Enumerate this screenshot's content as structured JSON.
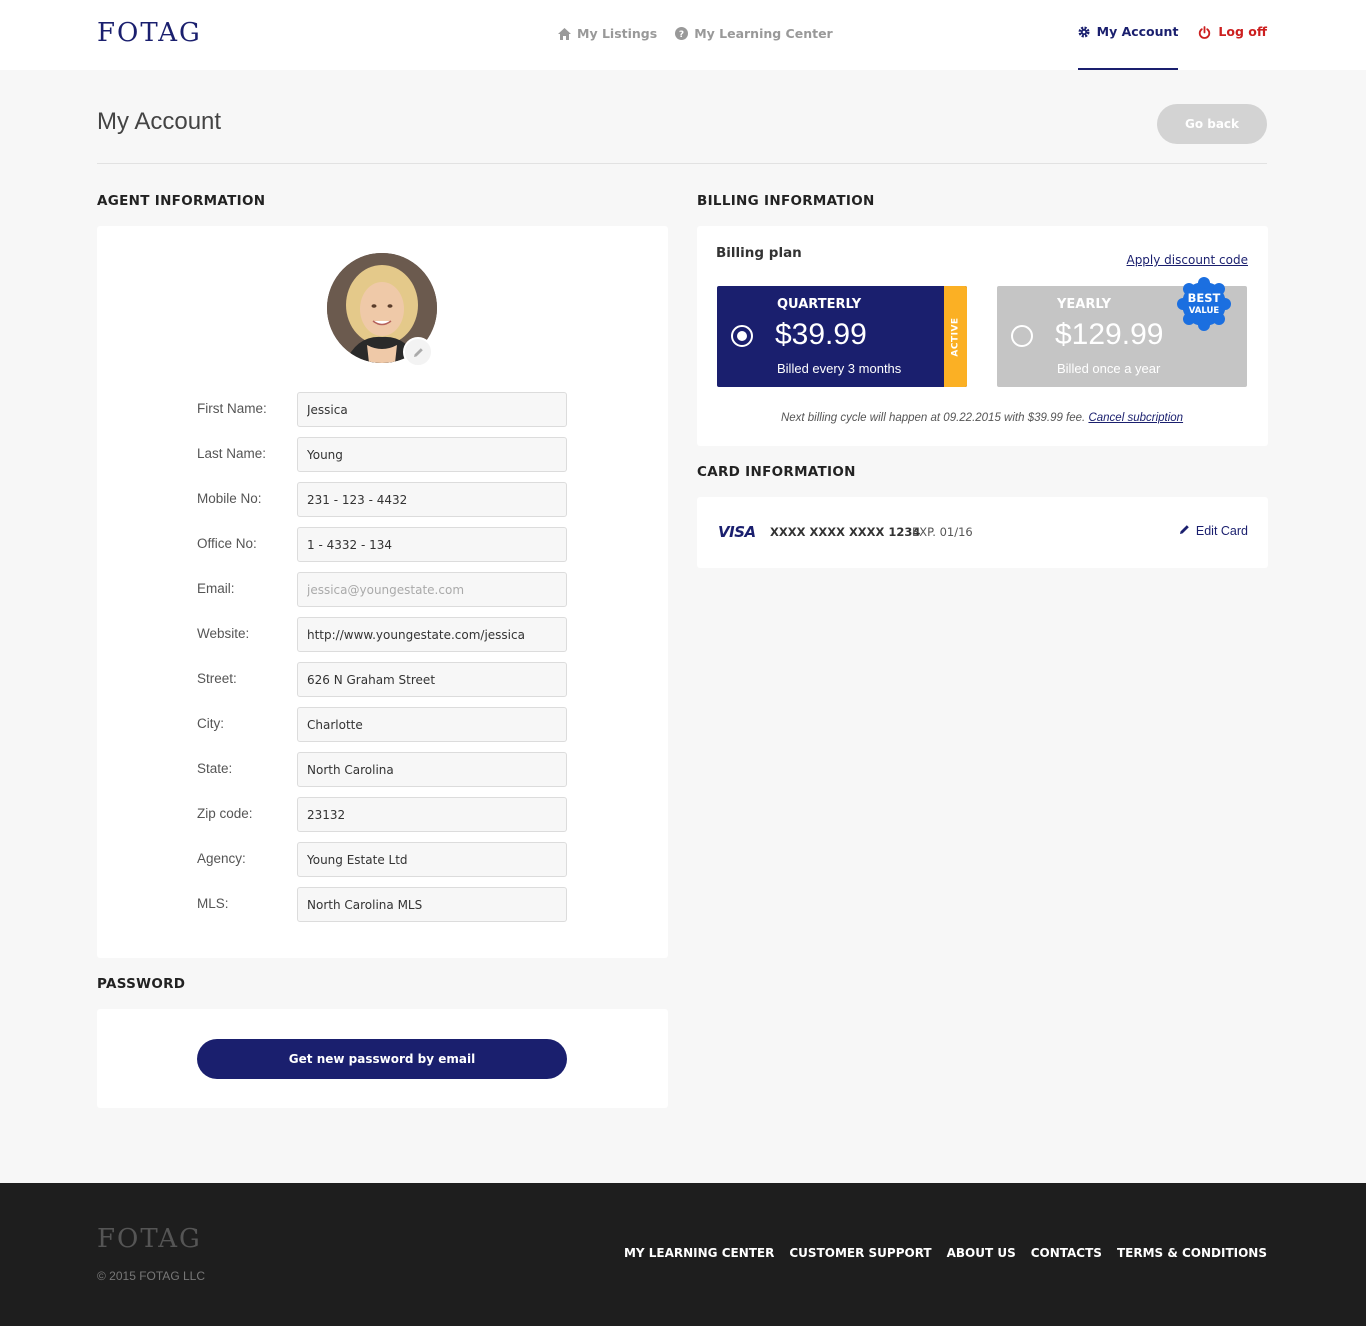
{
  "header": {
    "logo": "FOTAG",
    "nav": [
      {
        "label": "My Listings",
        "icon": "home-icon"
      },
      {
        "label": "My Learning Center",
        "icon": "question-circle-icon"
      }
    ],
    "account_label": "My Account",
    "logoff_label": "Log off"
  },
  "page": {
    "title": "My Account",
    "go_back_label": "Go back"
  },
  "agent": {
    "heading": "AGENT INFORMATION",
    "fields": [
      {
        "label": "First Name:",
        "value": "Jessica",
        "placeholder": ""
      },
      {
        "label": "Last Name:",
        "value": "Young",
        "placeholder": ""
      },
      {
        "label": "Mobile No:",
        "value": "231 - 123 - 4432",
        "placeholder": ""
      },
      {
        "label": "Office No:",
        "value": "1 - 4332 - 134",
        "placeholder": ""
      },
      {
        "label": "Email:",
        "value": "",
        "placeholder": "jessica@youngestate.com"
      },
      {
        "label": "Website:",
        "value": "http://www.youngestate.com/jessica",
        "placeholder": ""
      },
      {
        "label": "Street:",
        "value": "626 N Graham Street",
        "placeholder": ""
      },
      {
        "label": "City:",
        "value": "Charlotte",
        "placeholder": ""
      },
      {
        "label": "State:",
        "value": "North Carolina",
        "placeholder": ""
      },
      {
        "label": "Zip code:",
        "value": "23132",
        "placeholder": ""
      },
      {
        "label": "Agency:",
        "value": "Young Estate Ltd",
        "placeholder": ""
      },
      {
        "label": "MLS:",
        "value": "North Carolina MLS",
        "placeholder": ""
      }
    ]
  },
  "password": {
    "heading": "PASSWORD",
    "button_label": "Get new password by email"
  },
  "billing": {
    "heading": "BILLING INFORMATION",
    "plan_label": "Billing plan",
    "discount_link": "Apply discount code",
    "plans": [
      {
        "name": "QUARTERLY",
        "price": "$39.99",
        "sub": "Billed every 3 months",
        "selected": true,
        "badge": "ACTIVE"
      },
      {
        "name": "YEARLY",
        "price": "$129.99",
        "sub": "Billed once a year",
        "selected": false,
        "badge_line1": "BEST",
        "badge_line2": "VALUE"
      }
    ],
    "note": "Next billing cycle will happen at 09.22.2015 with $39.99 fee.",
    "cancel_link": "Cancel subcription"
  },
  "card": {
    "heading": "CARD INFORMATION",
    "brand": "VISA",
    "number": "XXXX XXXX XXXX 1234",
    "expiry": "EXP. 01/16",
    "edit_label": "Edit Card"
  },
  "footer": {
    "logo": "FOTAG",
    "copyright": "© 2015 FOTAG LLC",
    "links": [
      "MY LEARNING CENTER",
      "CUSTOMER SUPPORT",
      "ABOUT US",
      "CONTACTS",
      "TERMS & CONDITIONS"
    ]
  },
  "colors": {
    "brand_navy": "#1a1f6e",
    "active_orange": "#fbb024",
    "best_value_blue": "#1b6fe0",
    "logoff_red": "#cc1f1f"
  }
}
